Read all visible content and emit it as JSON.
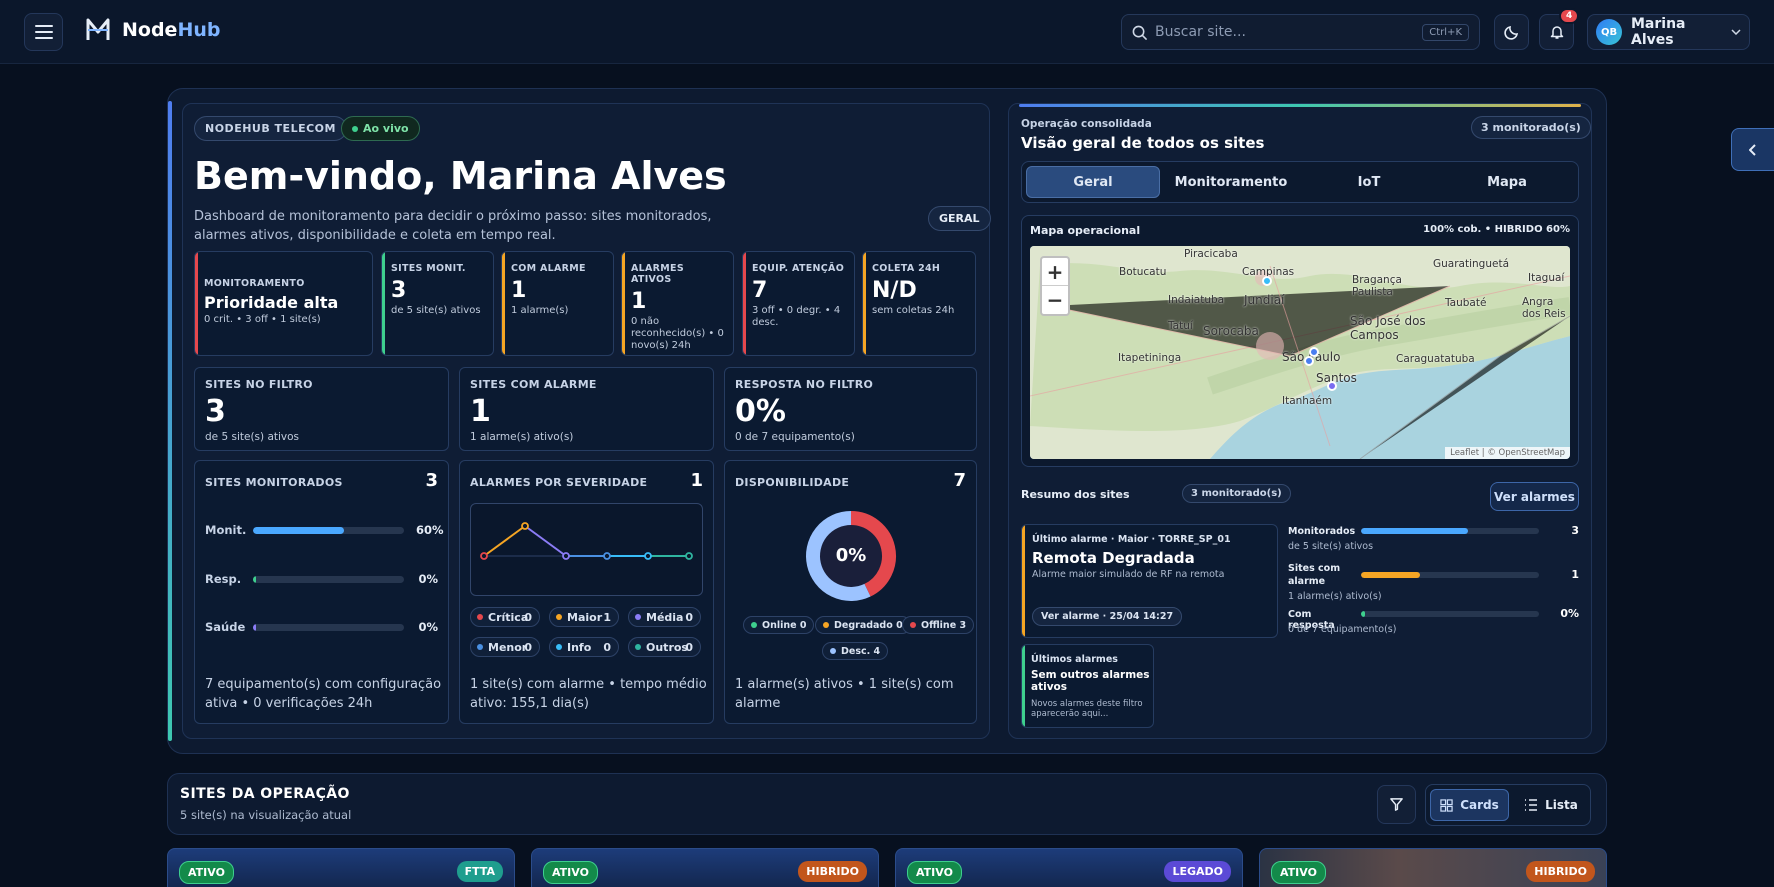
{
  "topbar": {
    "brand_a": "Node",
    "brand_b": "Hub",
    "search_placeholder": "Buscar site...",
    "search_shortcut": "Ctrl+K",
    "notifications_count": "4",
    "user_initials": "QB",
    "user_name": "Marina Alves"
  },
  "hero": {
    "company_tag": "NODEHUB TELECOM",
    "live_tag": "Ao vivo",
    "title": "Bem-vindo, Marina Alves",
    "description": "Dashboard de monitoramento para decidir o próximo passo: sites monitorados, alarmes ativos, disponibilidade e coleta em tempo real.",
    "scope_tag": "GERAL",
    "kpis": [
      {
        "label": "MONITORAMENTO",
        "value": "Prioridade alta",
        "sub": "0 crit. • 3 off • 1 site(s)",
        "color": "#e5484d"
      },
      {
        "label": "SITES MONIT.",
        "value": "3",
        "sub": "de 5 site(s) ativos",
        "color": "#3ecf8e"
      },
      {
        "label": "COM ALARME",
        "value": "1",
        "sub": "1 alarme(s)",
        "color": "#f5a524"
      },
      {
        "label": "ALARMES ATIVOS",
        "value": "1",
        "sub": "0 não reconhecido(s) • 0 novo(s) 24h",
        "color": "#f5a524"
      },
      {
        "label": "EQUIP. ATENÇÃO",
        "value": "7",
        "sub": "3 off • 0 degr. • 4 desc.",
        "color": "#e5484d"
      },
      {
        "label": "COLETA 24H",
        "value": "N/D",
        "sub": "sem coletas 24h",
        "color": "#f5a524"
      }
    ],
    "big_stats": [
      {
        "label": "SITES NO FILTRO",
        "value": "3",
        "sub": "de 5 site(s) ativos"
      },
      {
        "label": "SITES COM ALARME",
        "value": "1",
        "sub": "1 alarme(s) ativo(s)"
      },
      {
        "label": "RESPOSTA NO FILTRO",
        "value": "0%",
        "sub": "0 de 7 equipamento(s)"
      }
    ],
    "monitored": {
      "title": "SITES MONITORADOS",
      "count": "3",
      "rows": [
        {
          "label": "Monit.",
          "value": "60%",
          "fraction": 0.6,
          "color": "#4aa8ff"
        },
        {
          "label": "Resp.",
          "value": "0%",
          "fraction": 0.0,
          "color": "#3ecf8e"
        },
        {
          "label": "Saúde",
          "value": "0%",
          "fraction": 0.0,
          "color": "#8b7cf6"
        }
      ],
      "footer": "7 equipamento(s) com configuração ativa • 0 verificações 24h"
    },
    "severity": {
      "title": "ALARMES POR SEVERIDADE",
      "count": "1",
      "items": [
        {
          "label": "Crítica",
          "value": "0",
          "color": "#e5484d"
        },
        {
          "label": "Maior",
          "value": "1",
          "color": "#f5a524"
        },
        {
          "label": "Média",
          "value": "0",
          "color": "#8b7cf6"
        },
        {
          "label": "Menor",
          "value": "0",
          "color": "#4a90e2"
        },
        {
          "label": "Info",
          "value": "0",
          "color": "#38bdf8"
        },
        {
          "label": "Outros",
          "value": "0",
          "color": "#2fb5a0"
        }
      ],
      "footer": "1 site(s) com alarme • tempo médio ativo: 155,1 dia(s)"
    },
    "availability": {
      "title": "DISPONIBILIDADE",
      "count": "7",
      "center": "0%",
      "legend": [
        {
          "label": "Online 0",
          "value": 0,
          "color": "#3ecf8e"
        },
        {
          "label": "Degradado 0",
          "value": 0,
          "color": "#f5a524"
        },
        {
          "label": "Offline 3",
          "value": 3,
          "color": "#e5484d"
        },
        {
          "label": "Desc. 4",
          "value": 4,
          "color": "#9cc3ff"
        }
      ],
      "footer": "1 alarme(s) ativos • 1 site(s) com alarme"
    }
  },
  "overview": {
    "kicker": "Operação consolidada",
    "title": "Visão geral de todos os sites",
    "monitored_badge": "3 monitorado(s)",
    "tabs": [
      "Geral",
      "Monitoramento",
      "IoT",
      "Mapa"
    ],
    "map_title": "Mapa operacional",
    "map_coverage": "100% cob. • HIBRIDO 60%",
    "map_attribution": "Leaflet | © OpenStreetMap",
    "map_places": [
      "Piracicaba",
      "Campinas",
      "Guaratinguetá",
      "Botucatu",
      "Bragança Paulista",
      "Itaguaí",
      "Indaiatuba",
      "Jundiaí",
      "Taubaté",
      "Angra dos Reis",
      "Tatuí",
      "Sorocaba",
      "São José dos Campos",
      "Itapetininga",
      "São Paulo",
      "Caraguatatuba",
      "Santos",
      "Itanhaém"
    ],
    "summary_title": "Resumo dos sites",
    "summary_badge": "3 monitorado(s)",
    "alarms_button": "Ver alarmes",
    "last_alarm": {
      "kicker": "Último alarme · Maior · TORRE_SP_01",
      "title": "Remota Degradada",
      "desc": "Alarme maior simulado de RF na remota",
      "action": "Ver alarme · 25/04 14:27"
    },
    "recent": {
      "kicker": "Últimos alarmes",
      "title": "Sem outros alarmes ativos",
      "desc": "Novos alarmes deste filtro aparecerão aqui..."
    },
    "summary_rows": [
      {
        "label": "Monitorados",
        "value": "3",
        "sub": "de 5 site(s) ativos",
        "fraction": 0.6,
        "color": "#4aa8ff"
      },
      {
        "label": "Sites com alarme",
        "value": "1",
        "sub": "1 alarme(s) ativo(s)",
        "fraction": 0.33,
        "color": "#f5a524"
      },
      {
        "label": "Com resposta",
        "value": "0%",
        "sub": "0 de 7 equipamento(s)",
        "fraction": 0.0,
        "color": "#3ecf8e"
      }
    ]
  },
  "sites": {
    "title": "SITES DA OPERAÇÃO",
    "subtitle": "5 site(s) na visualização atual",
    "view_cards": "Cards",
    "view_list": "Lista",
    "cards": [
      {
        "status": "ATIVO",
        "type": "FTTA",
        "type_color": "#1f9e8e"
      },
      {
        "status": "ATIVO",
        "type": "HIBRIDO",
        "type_color": "#c2561c"
      },
      {
        "status": "ATIVO",
        "type": "LEGADO",
        "type_color": "#5b4ad6"
      },
      {
        "status": "ATIVO",
        "type": "HIBRIDO",
        "type_color": "#c2561c"
      }
    ]
  }
}
